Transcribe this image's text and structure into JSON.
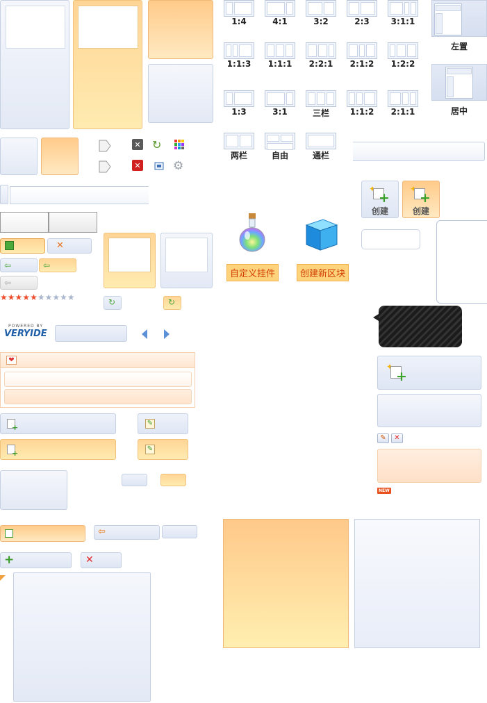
{
  "layouts": {
    "row1": [
      "1:4",
      "4:1",
      "3:2",
      "2:3",
      "3:1:1"
    ],
    "row2": [
      "1:1:3",
      "1:1:1",
      "2:2:1",
      "2:1:2",
      "1:2:2"
    ],
    "row3": [
      "1:3",
      "3:1",
      "三栏",
      "1:1:2",
      "2:1:1"
    ],
    "row4": [
      "两栏",
      "自由",
      "通栏"
    ],
    "left_label": "左置",
    "center_label": "居中"
  },
  "create": {
    "label_normal": "创建",
    "label_hover": "创建"
  },
  "widgets": {
    "custom_widget": "自定义挂件",
    "new_block": "创建新区块"
  },
  "brand": {
    "powered_by": "POWERED BY",
    "name": "VERYIDE"
  },
  "badge": {
    "new": "NEW"
  },
  "rating": {
    "filled": 5,
    "total": 10
  },
  "colors": {
    "accent_orange": "#ffd596",
    "accent_blue": "#dfe6f4",
    "star_on": "#ee4d2d",
    "star_off": "#aab6cc"
  }
}
